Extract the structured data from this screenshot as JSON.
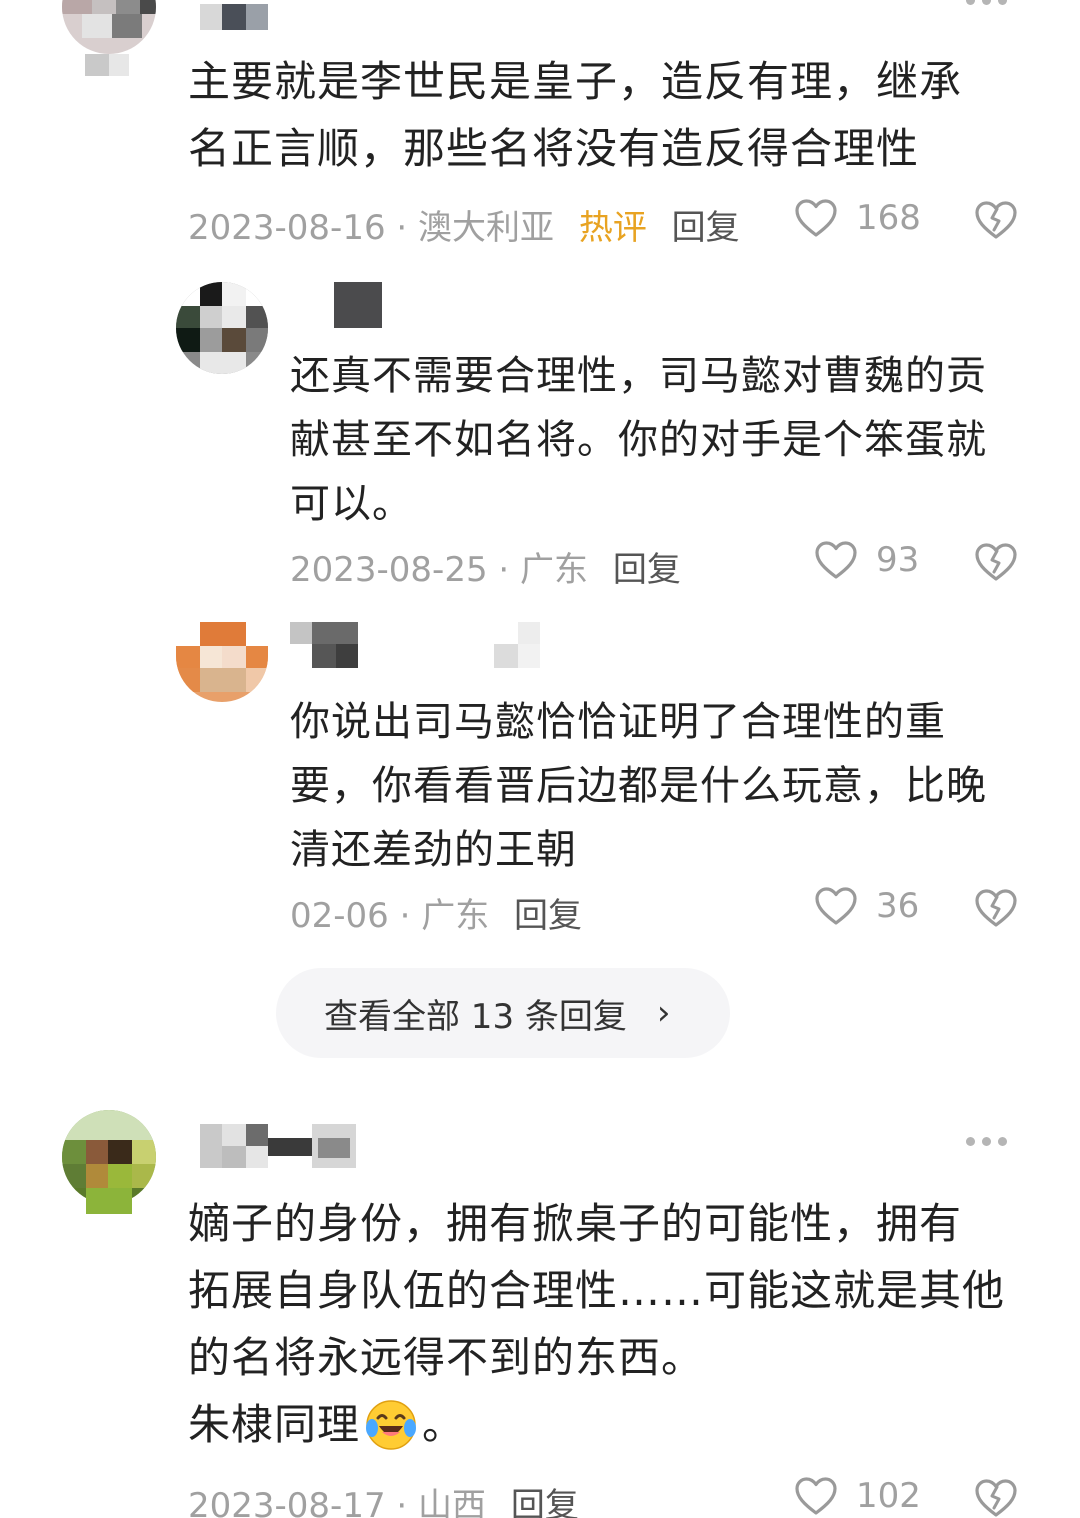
{
  "comments": [
    {
      "text_lines": [
        "主要就是李世民是皇子，造反有理，继承",
        "名正言顺，那些名将没有造反得合理性"
      ],
      "date": "2023-08-16",
      "location": "澳大利亚",
      "hot_badge": "热评",
      "reply_label": "回复",
      "likes": "168"
    },
    {
      "text_lines": [
        "嫡子的身份，拥有掀桌子的可能性，拥有",
        "拓展自身队伍的合理性……可能这就是其他",
        "的名将永远得不到的东西。",
        "朱棣同理",
        "。"
      ],
      "date": "2023-08-17",
      "location": "山西",
      "reply_label": "回复",
      "likes": "102"
    }
  ],
  "replies": [
    {
      "text_lines": [
        "还真不需要合理性，司马懿对曹魏的贡",
        "献甚至不如名将。你的对手是个笨蛋就",
        "可以。"
      ],
      "date": "2023-08-25",
      "location": "广东",
      "reply_label": "回复",
      "likes": "93"
    },
    {
      "text_lines": [
        "你说出司马懿恰恰证明了合理性的重",
        "要，你看看晋后边都是什么玩意，比晚",
        "清还差劲的王朝"
      ],
      "date": "02-06",
      "location": "广东",
      "reply_label": "回复",
      "likes": "36"
    }
  ],
  "view_all": {
    "label": "查看全部 13 条回复",
    "chevron": "›"
  },
  "separator": " · ",
  "icons": {
    "like": "heart-outline-icon",
    "dislike": "broken-heart-icon",
    "more": "more-dots-icon",
    "emoji": "crying-laughing-emoji"
  },
  "colors": {
    "hot": "#e8a322",
    "meta": "#a0a0a0",
    "text": "#222222"
  }
}
